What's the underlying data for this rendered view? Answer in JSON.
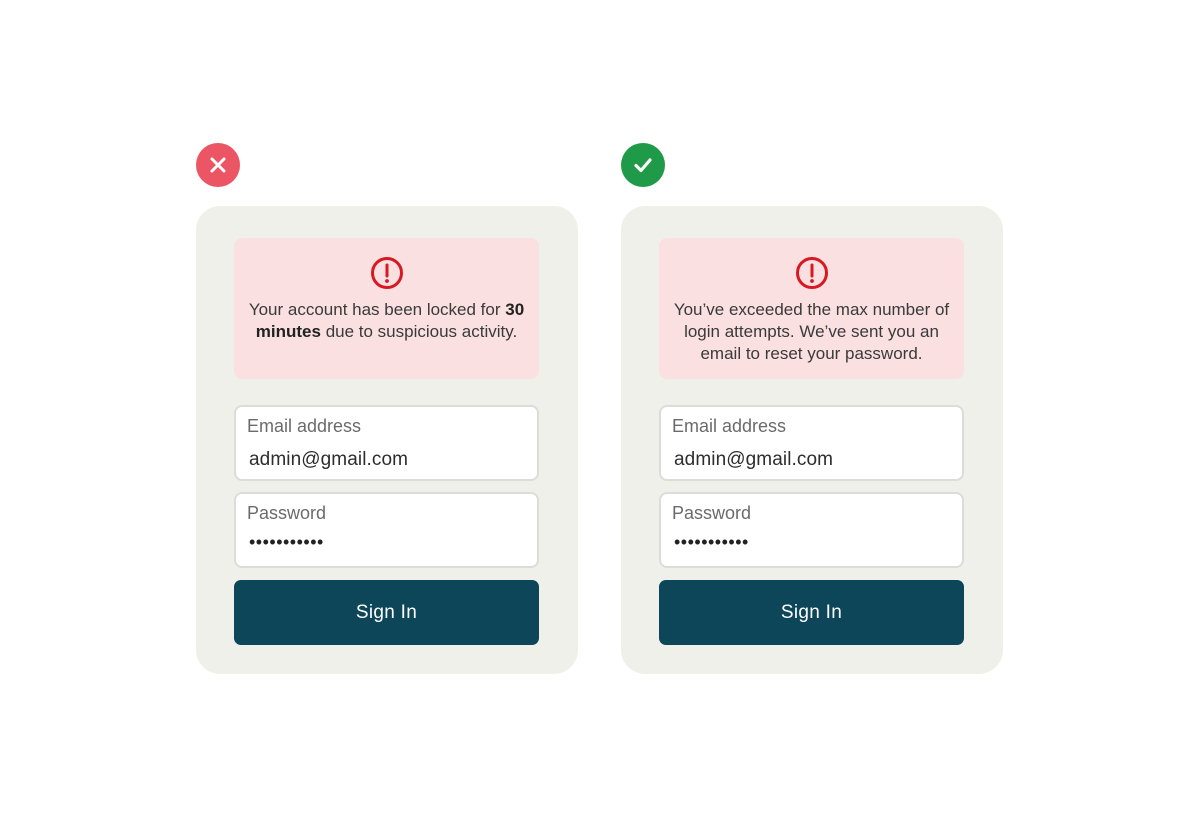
{
  "colors": {
    "bad_badge": "#ec5563",
    "good_badge": "#1f9a48",
    "card_bg": "#f0f0eb",
    "alert_bg": "#fae0e1",
    "alert_icon": "#d81921",
    "button_bg": "#0c4658",
    "button_text": "#ffffff"
  },
  "bad_example": {
    "badge_icon": "x-icon",
    "alert": {
      "icon": "exclamation-circle-icon",
      "text_before": "Your account has been locked for ",
      "text_bold": "30 minutes",
      "text_after": " due to suspicious activity."
    },
    "email": {
      "label": "Email address",
      "value": "admin@gmail.com"
    },
    "password": {
      "label": "Password",
      "value": "•••••••••••"
    },
    "button_label": "Sign In"
  },
  "good_example": {
    "badge_icon": "checkmark-icon",
    "alert": {
      "icon": "exclamation-circle-icon",
      "text": "You’ve exceeded the max number of login attempts. We’ve sent you an email to reset your password."
    },
    "email": {
      "label": "Email address",
      "value": "admin@gmail.com"
    },
    "password": {
      "label": "Password",
      "value": "•••••••••••"
    },
    "button_label": "Sign In"
  }
}
